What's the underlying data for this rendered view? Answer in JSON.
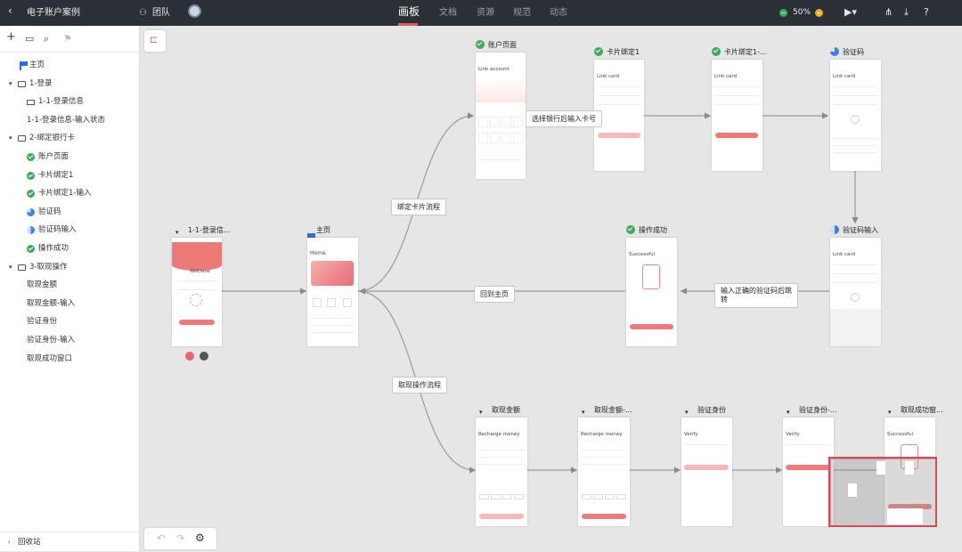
{
  "topbar": {
    "back": "‹",
    "project": "电子账户案例",
    "team": "团队",
    "tabs": [
      "画板",
      "文档",
      "资源",
      "规范",
      "动态"
    ],
    "zoom": "50%",
    "minus": "−",
    "plus": "+"
  },
  "sidebar": {
    "tools": [
      "+",
      "▭",
      "⌕",
      "⚑"
    ],
    "items": [
      {
        "label": "主页",
        "indent": 20
      },
      {
        "label": "1-登录",
        "indent": 10
      },
      {
        "label": "1-1-登录信息",
        "indent": 30
      },
      {
        "label": "1-1-登录信息-输入状态",
        "indent": 30
      },
      {
        "label": "2-绑定银行卡",
        "indent": 10
      },
      {
        "label": "账户页面",
        "indent": 30
      },
      {
        "label": "卡片绑定1",
        "indent": 30
      },
      {
        "label": "卡片绑定1-输入",
        "indent": 30
      },
      {
        "label": "验证码",
        "indent": 30
      },
      {
        "label": "验证码输入",
        "indent": 30
      },
      {
        "label": "操作成功",
        "indent": 30
      },
      {
        "label": "3-取现操作",
        "indent": 10
      },
      {
        "label": "取现金额",
        "indent": 30
      },
      {
        "label": "取现金额-输入",
        "indent": 30
      },
      {
        "label": "验证身份",
        "indent": 30
      },
      {
        "label": "验证身份-输入",
        "indent": 30
      },
      {
        "label": "取现成功窗口",
        "indent": 30
      }
    ],
    "recycle": "回收站"
  },
  "screens": {
    "login": "1-1-登录信...",
    "home": "主页",
    "account": "账户页面",
    "card1": "卡片绑定1",
    "card1input": "卡片绑定1-...",
    "code": "验证码",
    "codeinput": "验证码输入",
    "success": "操作成功",
    "withdraw": "取现金额",
    "withdrawinput": "取现金额-...",
    "verify": "验证身份",
    "verifyinput": "验证身份-...",
    "withdrawsuccess": "取现成功窗..."
  },
  "edges": {
    "bind": "绑定卡片流程",
    "selectbank": "选择银行后输入卡号",
    "backhome": "回到主页",
    "afterinput": "输入正确的验证码后跳\n转",
    "withdraw": "取现操作流程"
  },
  "mock": {
    "link_account": "Link account",
    "link_card": "Link card",
    "home": "Home",
    "successful": "Successful",
    "recharge": "Recharge money",
    "verify": "Verify",
    "welcome": "Welcome"
  },
  "colors": {
    "accent": "#e25a5a",
    "topbar": "#2b2f36",
    "check": "#3daa5c",
    "progress": "#3a82e8"
  }
}
